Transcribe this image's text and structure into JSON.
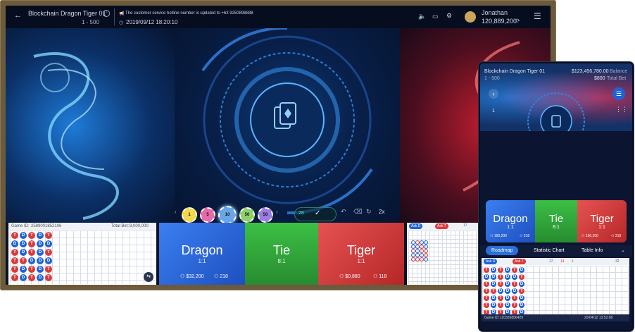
{
  "desktop": {
    "title": "Blockchain Dragon Tiger 01",
    "range": "1 - 500",
    "notice": "The customer service hotline number is updated to +63 9250898888",
    "datetime": "2019/09/12 18:20:10",
    "user": "Jonathan",
    "balance": "120,889,200",
    "round": "2589001852106",
    "game_id_label": "Game ID:",
    "total_bet_label": "Total Bet:",
    "total_bet": "8,000,000",
    "count": "28",
    "multiplier": "2x",
    "chips": [
      {
        "value": "1",
        "color": "#f0d84a"
      },
      {
        "value": "5",
        "color": "#e46aa8"
      },
      {
        "value": "10",
        "color": "#6aa6e6"
      },
      {
        "value": "50",
        "color": "#8ed06a"
      },
      {
        "value": "50",
        "color": "#9a7de0"
      }
    ],
    "bets": {
      "dragon": {
        "name": "Dragon",
        "odds": "1:1",
        "amount": "$32,200",
        "players": "218"
      },
      "tie": {
        "name": "Tie",
        "odds": "8:1"
      },
      "tiger": {
        "name": "Tiger",
        "odds": "1:1",
        "amount": "$0,880",
        "players": "118"
      }
    },
    "road_badges": [
      "Ask D",
      "Ask T"
    ],
    "road_counts": [
      "17",
      "14",
      "1"
    ],
    "bead_road": [
      [
        "T",
        "D",
        "T",
        "D",
        "T"
      ],
      [
        "D",
        "D",
        "T",
        "D",
        "D"
      ],
      [
        "T",
        "D",
        "T",
        "D",
        "T"
      ],
      [
        "T",
        "T",
        "D",
        "D",
        "D"
      ],
      [
        "T",
        "D",
        "T",
        "D",
        "T"
      ],
      [
        "T",
        "D",
        "T",
        "D",
        "T"
      ]
    ]
  },
  "mobile": {
    "title": "Blockchain Dragon Tiger 01",
    "range": "1 - 500",
    "balance": "$123,456,780.00",
    "balance_label": "Balance",
    "total_bet": "$800",
    "total_bet_label": "Total Bet",
    "page_num": "1",
    "bets": {
      "dragon": {
        "name": "Dragon",
        "odds": "1:1",
        "amount": "190,200",
        "players": "218"
      },
      "tie": {
        "name": "Tie",
        "odds": "8:1"
      },
      "tiger": {
        "name": "Tiger",
        "odds": "1:1",
        "amount": "190,200",
        "players": "218"
      }
    },
    "tabs": [
      "Roadmap",
      "Statistic Chart",
      "Table Info"
    ],
    "road_badges": [
      "Ask D",
      "Ask T"
    ],
    "road_counts": [
      "17",
      "14",
      "1",
      "32"
    ],
    "game_id_label": "Game ID:",
    "game_id": "110326856429",
    "timestamp": "20/04/12 13:52:08",
    "bead_road": [
      [
        "T",
        "D",
        "T",
        "D",
        "T",
        "D"
      ],
      [
        "D",
        "D",
        "T",
        "D",
        "D",
        "T"
      ],
      [
        "T",
        "D",
        "T",
        "D",
        "T",
        "D"
      ],
      [
        "T",
        "T",
        "D",
        "D",
        "D",
        "T"
      ],
      [
        "T",
        "D",
        "T",
        "D",
        "T",
        "D"
      ],
      [
        "T",
        "D",
        "T",
        "D",
        "T",
        "D"
      ],
      [
        "T",
        "D",
        "T",
        "D",
        "T",
        "D"
      ]
    ]
  },
  "colors": {
    "dragon": "#1e63d6",
    "tie": "#2f9b3d",
    "tiger": "#d93b3b",
    "frame": "#6b5a3c"
  }
}
